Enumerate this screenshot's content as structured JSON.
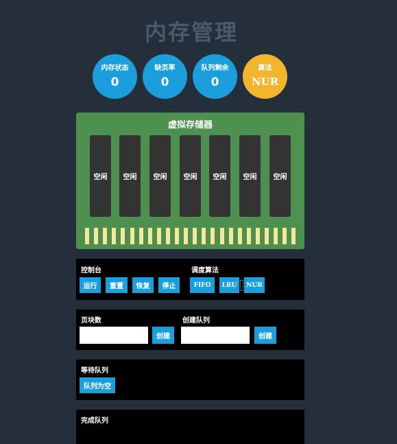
{
  "header": {
    "title": "内存管理"
  },
  "stats": [
    {
      "label": "内存状态",
      "value": "0"
    },
    {
      "label": "缺页率",
      "value": "0"
    },
    {
      "label": "队列剩余",
      "value": "0"
    },
    {
      "label": "算法",
      "value": "NUR"
    }
  ],
  "colors": {
    "accent": "#1a9fdc",
    "gold": "#f4b52e",
    "memory": "#4e9050",
    "pin": "#f7e79b",
    "background": "#252f3b"
  },
  "memory": {
    "title": "虚拟存储器",
    "slots": [
      "空闲",
      "空闲",
      "空闲",
      "空闲",
      "空闲",
      "空闲",
      "空闲"
    ]
  },
  "console": {
    "label": "控制台",
    "buttons": [
      "运行",
      "重置",
      "恢复",
      "停止"
    ],
    "algo_label": "调度算法",
    "algorithms": [
      "FIFO",
      "LRU",
      "NUR"
    ]
  },
  "create": {
    "pages_label": "页块数",
    "pages_value": "",
    "create_label": "创建",
    "queue_label": "创建队列",
    "queue_value": ""
  },
  "waiting": {
    "label": "等待队列",
    "empty_label": "队列为空"
  },
  "done": {
    "label": "完成队列"
  }
}
